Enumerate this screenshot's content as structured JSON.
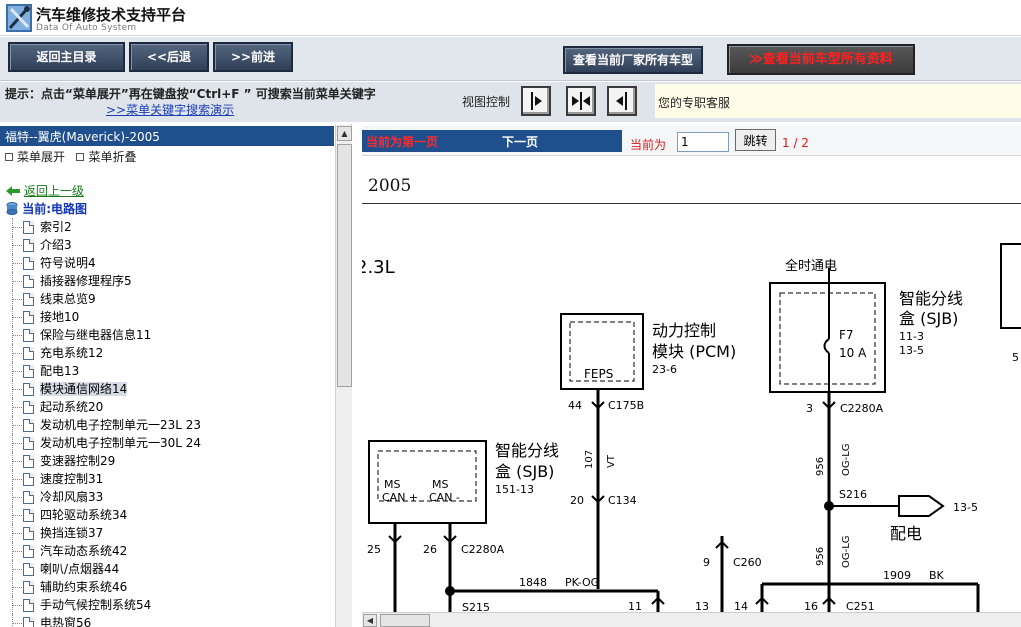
{
  "app": {
    "title": "汽车维修技术支持平台",
    "subtitle": "Data Of Auto System"
  },
  "toolbar": {
    "home_label": "返回主目录",
    "back_label": "<<后退",
    "forward_label": ">>前进",
    "maker_models_label": "查看当前厂家所有车型",
    "model_data_label": "≫查看当前车型所有资料"
  },
  "hint": {
    "text": "提示：点击“菜单展开”再在键盘按“Ctrl+F ”  可搜索当前菜单关键字",
    "link": ">>菜单关键字搜索演示",
    "view_label": "视图控制",
    "support": "您的专职客服"
  },
  "sidebar": {
    "model": "福特--翼虎(Maverick)-2005",
    "expand_label": "菜单展开",
    "collapse_label": "菜单折叠",
    "back_up": "返回上一级",
    "current_prefix": "当前:",
    "current": "电路图",
    "items": [
      {
        "label": "索引2"
      },
      {
        "label": "介绍3"
      },
      {
        "label": "符号说明4"
      },
      {
        "label": "插接器修理程序5"
      },
      {
        "label": "线束总览9"
      },
      {
        "label": "接地10"
      },
      {
        "label": "保险与继电器信息11"
      },
      {
        "label": "充电系统12"
      },
      {
        "label": "配电13"
      },
      {
        "label": "模块通信网络14"
      },
      {
        "label": "起动系统20"
      },
      {
        "label": "发动机电子控制单元一23L 23"
      },
      {
        "label": "发动机电子控制单元一30L 24"
      },
      {
        "label": "变速器控制29"
      },
      {
        "label": "速度控制31"
      },
      {
        "label": "冷却风扇33"
      },
      {
        "label": "四轮驱动系统34"
      },
      {
        "label": "换挡连锁37"
      },
      {
        "label": "汽车动态系统42"
      },
      {
        "label": "喇叭/点烟器44"
      },
      {
        "label": "辅助约束系统46"
      },
      {
        "label": "手动气候控制系统54"
      },
      {
        "label": "电热窗56"
      }
    ],
    "active_index": 9
  },
  "content": {
    "pager": {
      "first_page": "当前为第一页",
      "next_page": "下一页",
      "current_label": "当前为",
      "page_value": "1",
      "jump_label": "跳转",
      "page_count": "1 / 2"
    },
    "year": "2005"
  },
  "diagram": {
    "engine": "2.3L",
    "always_hot": "全时通电",
    "pcm_title_1": "动力控制",
    "pcm_title_2": "模块 (PCM)",
    "pcm_ref": "23-6",
    "feps": "FEPS",
    "sjb_title_1": "智能分线",
    "sjb_title_2": "盒 (SJB)",
    "sjb_ref_top_1": "11-3",
    "sjb_ref_top_2": "13-5",
    "sjb_ref_left": "151-13",
    "fuse": "F7",
    "fuse_amp": "10 A",
    "ms_can_plus_1": "MS",
    "ms_can_plus_2": "CAN +",
    "ms_can_minus_1": "MS",
    "ms_can_minus_2": "CAN -",
    "pin_44": "44",
    "c175b": "C175B",
    "wire_107": "107",
    "vt": "VT",
    "pin_20": "20",
    "c134": "C134",
    "pin_3": "3",
    "c2280a_top": "C2280A",
    "wire_956_a": "956",
    "og_lg_a": "OG-LG",
    "s216": "S216",
    "ref_13_5": "13-5",
    "distribution": "配电",
    "wire_956_b": "956",
    "og_lg_b": "OG-LG",
    "pin_25": "25",
    "pin_26": "26",
    "c2280a_left": "C2280A",
    "wire_1848": "1848",
    "pk_og": "PK-OG",
    "s215": "S215",
    "pin_9": "9",
    "c260": "C260",
    "pin_11": "11",
    "pin_13": "13",
    "pin_14": "14",
    "pin_16": "16",
    "c251": "C251",
    "wire_1909": "1909",
    "bk": "BK",
    "edge_5": "5"
  }
}
